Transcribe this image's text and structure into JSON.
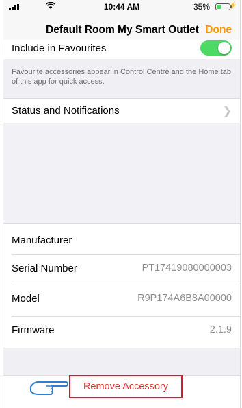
{
  "status_bar": {
    "time": "10:44 AM",
    "battery": "35%",
    "battery_level": 0.35,
    "icons": [
      "signal-icon",
      "wifi-icon",
      "battery-icon",
      "charging-bolt-icon"
    ]
  },
  "nav": {
    "title": "Default Room My Smart Outlet",
    "done": "Done"
  },
  "favourites": {
    "label": "Include in Favourites",
    "enabled": true,
    "footnote": "Favourite accessories appear in Control Centre and the Home tab of this app for quick access."
  },
  "status_notifications": {
    "label": "Status and Notifications"
  },
  "info": {
    "manufacturer_label": "Manufacturer",
    "serial_label": "Serial Number",
    "serial_value": "PT17419080000003",
    "model_label": "Model",
    "model_value": "R9P174A6B8A00000",
    "firmware_label": "Firmware",
    "firmware_value": "2.1.9"
  },
  "remove": {
    "label": "Remove Accessory"
  },
  "colors": {
    "accent": "#ff9500",
    "toggle_on": "#4cd964",
    "destructive": "#e0312f",
    "highlight_border": "#cc2233"
  }
}
